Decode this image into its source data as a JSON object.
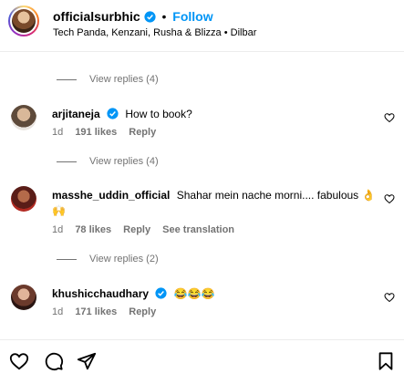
{
  "header": {
    "username": "officialsurbhic",
    "separator": "•",
    "follow_label": "Follow",
    "subtitle": "Tech Panda, Kenzani, Rusha & Blizza • Dilbar"
  },
  "replies": [
    {
      "label": "View replies (4)"
    },
    {
      "label": "View replies (4)"
    },
    {
      "label": "View replies (2)"
    }
  ],
  "comments": [
    {
      "username": "arjitaneja",
      "verified": true,
      "text": "How to book?",
      "time": "1d",
      "likes": "191 likes",
      "reply": "Reply"
    },
    {
      "username": "masshe_uddin_official",
      "verified": false,
      "text": "Shahar mein nache morni.... fabulous 👌🙌",
      "time": "1d",
      "likes": "78 likes",
      "reply": "Reply",
      "translate": "See translation"
    },
    {
      "username": "khushicchaudhary",
      "verified": true,
      "text": "😂😂😂",
      "time": "1d",
      "likes": "171 likes",
      "reply": "Reply"
    }
  ],
  "colors": {
    "follow": "#0095f6",
    "verified": "#0095f6",
    "muted": "#737373"
  },
  "footer_icons": [
    "heart-icon",
    "comment-icon",
    "share-icon",
    "bookmark-icon"
  ]
}
